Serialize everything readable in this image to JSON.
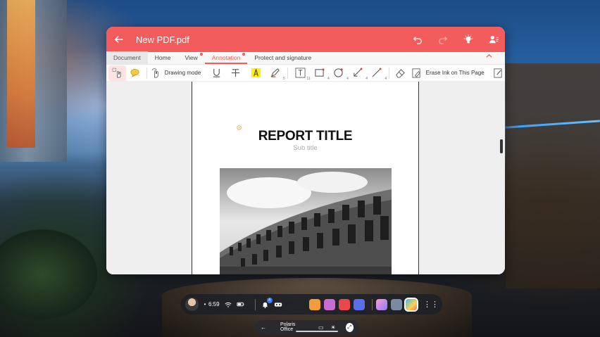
{
  "window": {
    "title": "New PDF.pdf",
    "accent_color": "#f25c5c"
  },
  "tabs": [
    {
      "label": "Document",
      "dot": false
    },
    {
      "label": "Home",
      "dot": false
    },
    {
      "label": "View",
      "dot": true
    },
    {
      "label": "Annotation",
      "dot": true,
      "active": true
    },
    {
      "label": "Protect and signature",
      "dot": false
    }
  ],
  "toolbar": {
    "drawing_mode_label": "Drawing mode",
    "erase_ink_label": "Erase Ink on This Page",
    "sub_labels": {
      "pen": "5",
      "textbox": "11",
      "rect": "4",
      "ellipse": "4",
      "arrow": "4",
      "line": "4"
    }
  },
  "document": {
    "title": "REPORT TITLE",
    "subtitle": "Sub title"
  },
  "dock": {
    "time": "6:59",
    "notification_badge": "4"
  },
  "taskbar": {
    "app_label": "Polaris Office"
  }
}
